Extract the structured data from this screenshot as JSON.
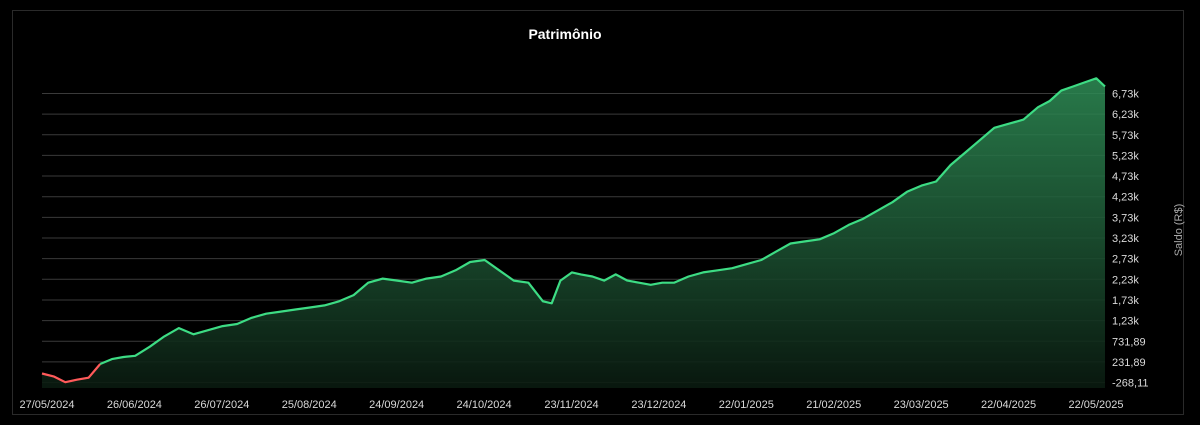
{
  "chart_data": {
    "type": "area",
    "title": "Patrimônio",
    "ylabel": "Saldo (R$)",
    "xlabel": "",
    "x_ticks": [
      "27/05/2024",
      "26/06/2024",
      "26/07/2024",
      "25/08/2024",
      "24/09/2024",
      "24/10/2024",
      "23/11/2024",
      "23/12/2024",
      "22/01/2025",
      "21/02/2025",
      "23/03/2025",
      "22/04/2025",
      "22/05/2025"
    ],
    "y_ticks": [
      "-268,11",
      "231,89",
      "731,89",
      "1,23k",
      "1,73k",
      "2,23k",
      "2,73k",
      "3,23k",
      "3,73k",
      "4,23k",
      "4,73k",
      "5,23k",
      "5,73k",
      "6,23k",
      "6,73k"
    ],
    "y_tick_values": [
      -268.11,
      231.89,
      731.89,
      1231.89,
      1731.89,
      2231.89,
      2731.89,
      3231.89,
      3731.89,
      4231.89,
      4731.89,
      5231.89,
      5731.89,
      6231.89,
      6731.89
    ],
    "ylim": [
      -400,
      7300
    ],
    "grid": true,
    "colors": {
      "positive_line": "#3ddc84",
      "negative_line": "#ff5a5a",
      "fill_top": "#2f8f57",
      "fill_bottom": "#0a1a10"
    },
    "series": [
      {
        "x": [
          "2024-05-27",
          "2024-05-31",
          "2024-06-04",
          "2024-06-08",
          "2024-06-12",
          "2024-06-16",
          "2024-06-20",
          "2024-06-24",
          "2024-06-28",
          "2024-07-03",
          "2024-07-08",
          "2024-07-13",
          "2024-07-18",
          "2024-07-23",
          "2024-07-28",
          "2024-08-02",
          "2024-08-07",
          "2024-08-12",
          "2024-08-17",
          "2024-08-22",
          "2024-08-27",
          "2024-09-01",
          "2024-09-06",
          "2024-09-11",
          "2024-09-16",
          "2024-09-21",
          "2024-09-26",
          "2024-10-01",
          "2024-10-06",
          "2024-10-11",
          "2024-10-16",
          "2024-10-21",
          "2024-10-26",
          "2024-10-31",
          "2024-11-05",
          "2024-11-10",
          "2024-11-15",
          "2024-11-18",
          "2024-11-21",
          "2024-11-25",
          "2024-11-28",
          "2024-12-02",
          "2024-12-06",
          "2024-12-10",
          "2024-12-14",
          "2024-12-18",
          "2024-12-22",
          "2024-12-26",
          "2024-12-30",
          "2025-01-04",
          "2025-01-09",
          "2025-01-14",
          "2025-01-19",
          "2025-01-24",
          "2025-01-29",
          "2025-02-03",
          "2025-02-08",
          "2025-02-13",
          "2025-02-18",
          "2025-02-23",
          "2025-02-28",
          "2025-03-05",
          "2025-03-10",
          "2025-03-15",
          "2025-03-20",
          "2025-03-25",
          "2025-03-30",
          "2025-04-04",
          "2025-04-09",
          "2025-04-14",
          "2025-04-19",
          "2025-04-24",
          "2025-04-29",
          "2025-05-04",
          "2025-05-08",
          "2025-05-12",
          "2025-05-16",
          "2025-05-20",
          "2025-05-24",
          "2025-05-27"
        ],
        "y": [
          -50,
          -120,
          -260,
          -200,
          -150,
          180,
          300,
          350,
          380,
          600,
          850,
          1050,
          900,
          1000,
          1100,
          1150,
          1300,
          1400,
          1450,
          1500,
          1550,
          1600,
          1700,
          1850,
          2150,
          2250,
          2200,
          2150,
          2250,
          2300,
          2450,
          2650,
          2700,
          2450,
          2200,
          2150,
          1700,
          1650,
          2200,
          2400,
          2350,
          2300,
          2200,
          2350,
          2200,
          2150,
          2100,
          2150,
          2150,
          2300,
          2400,
          2450,
          2500,
          2600,
          2700,
          2900,
          3100,
          3150,
          3200,
          3350,
          3550,
          3700,
          3900,
          4100,
          4350,
          4500,
          4600,
          5000,
          5300,
          5600,
          5900,
          6000,
          6100,
          6400,
          6550,
          6800,
          6900,
          7000,
          7100,
          6900
        ]
      }
    ]
  }
}
